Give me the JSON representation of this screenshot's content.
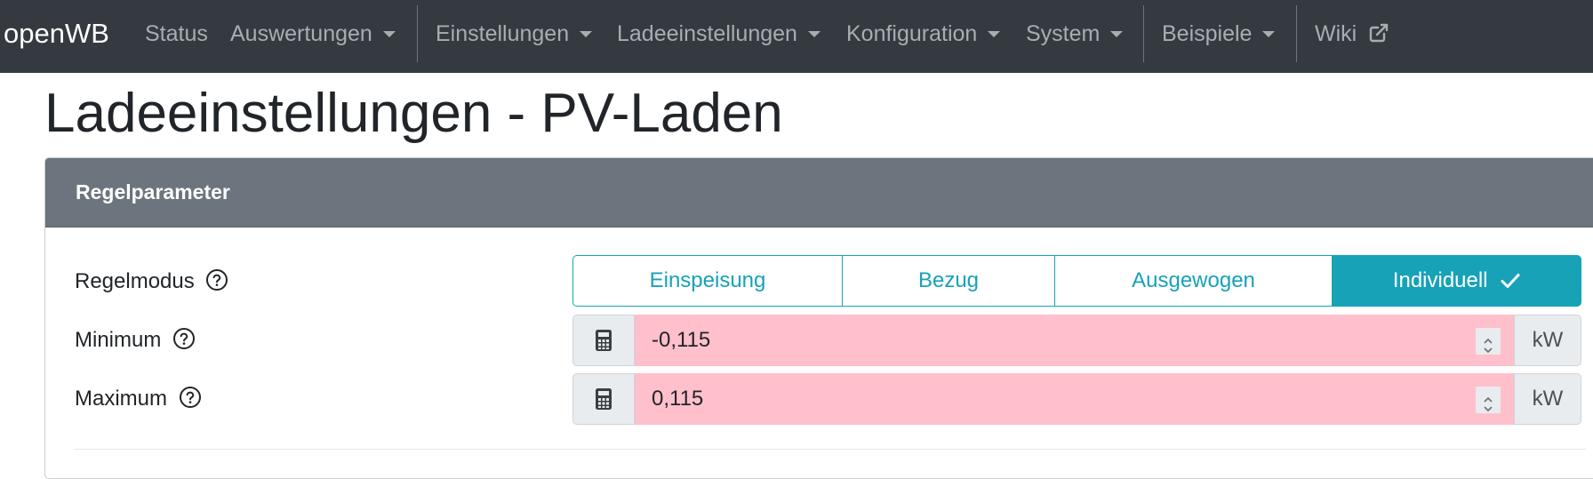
{
  "navbar": {
    "brand": "openWB",
    "items": [
      {
        "label": "Status",
        "dropdown": false
      },
      {
        "label": "Auswertungen",
        "dropdown": true
      },
      {
        "label": "Einstellungen",
        "dropdown": true
      },
      {
        "label": "Ladeeinstellungen",
        "dropdown": true
      },
      {
        "label": "Konfiguration",
        "dropdown": true
      },
      {
        "label": "System",
        "dropdown": true
      },
      {
        "label": "Beispiele",
        "dropdown": true
      },
      {
        "label": "Wiki",
        "dropdown": false,
        "icon": "external-link-icon"
      }
    ]
  },
  "page": {
    "title": "Ladeeinstellungen - PV-Laden"
  },
  "card": {
    "header": "Regelparameter",
    "regelmodus": {
      "label": "Regelmodus",
      "options": [
        "Einspeisung",
        "Bezug",
        "Ausgewogen",
        "Individuell"
      ],
      "selected": "Individuell"
    },
    "minimum": {
      "label": "Minimum",
      "value": "-0,115",
      "unit": "kW"
    },
    "maximum": {
      "label": "Maximum",
      "value": "0,115",
      "unit": "kW"
    }
  },
  "colors": {
    "navbar_bg": "#343a40",
    "card_header_bg": "#6c757d",
    "accent": "#17a2b8",
    "invalid_field_bg": "#ffc0cb"
  }
}
